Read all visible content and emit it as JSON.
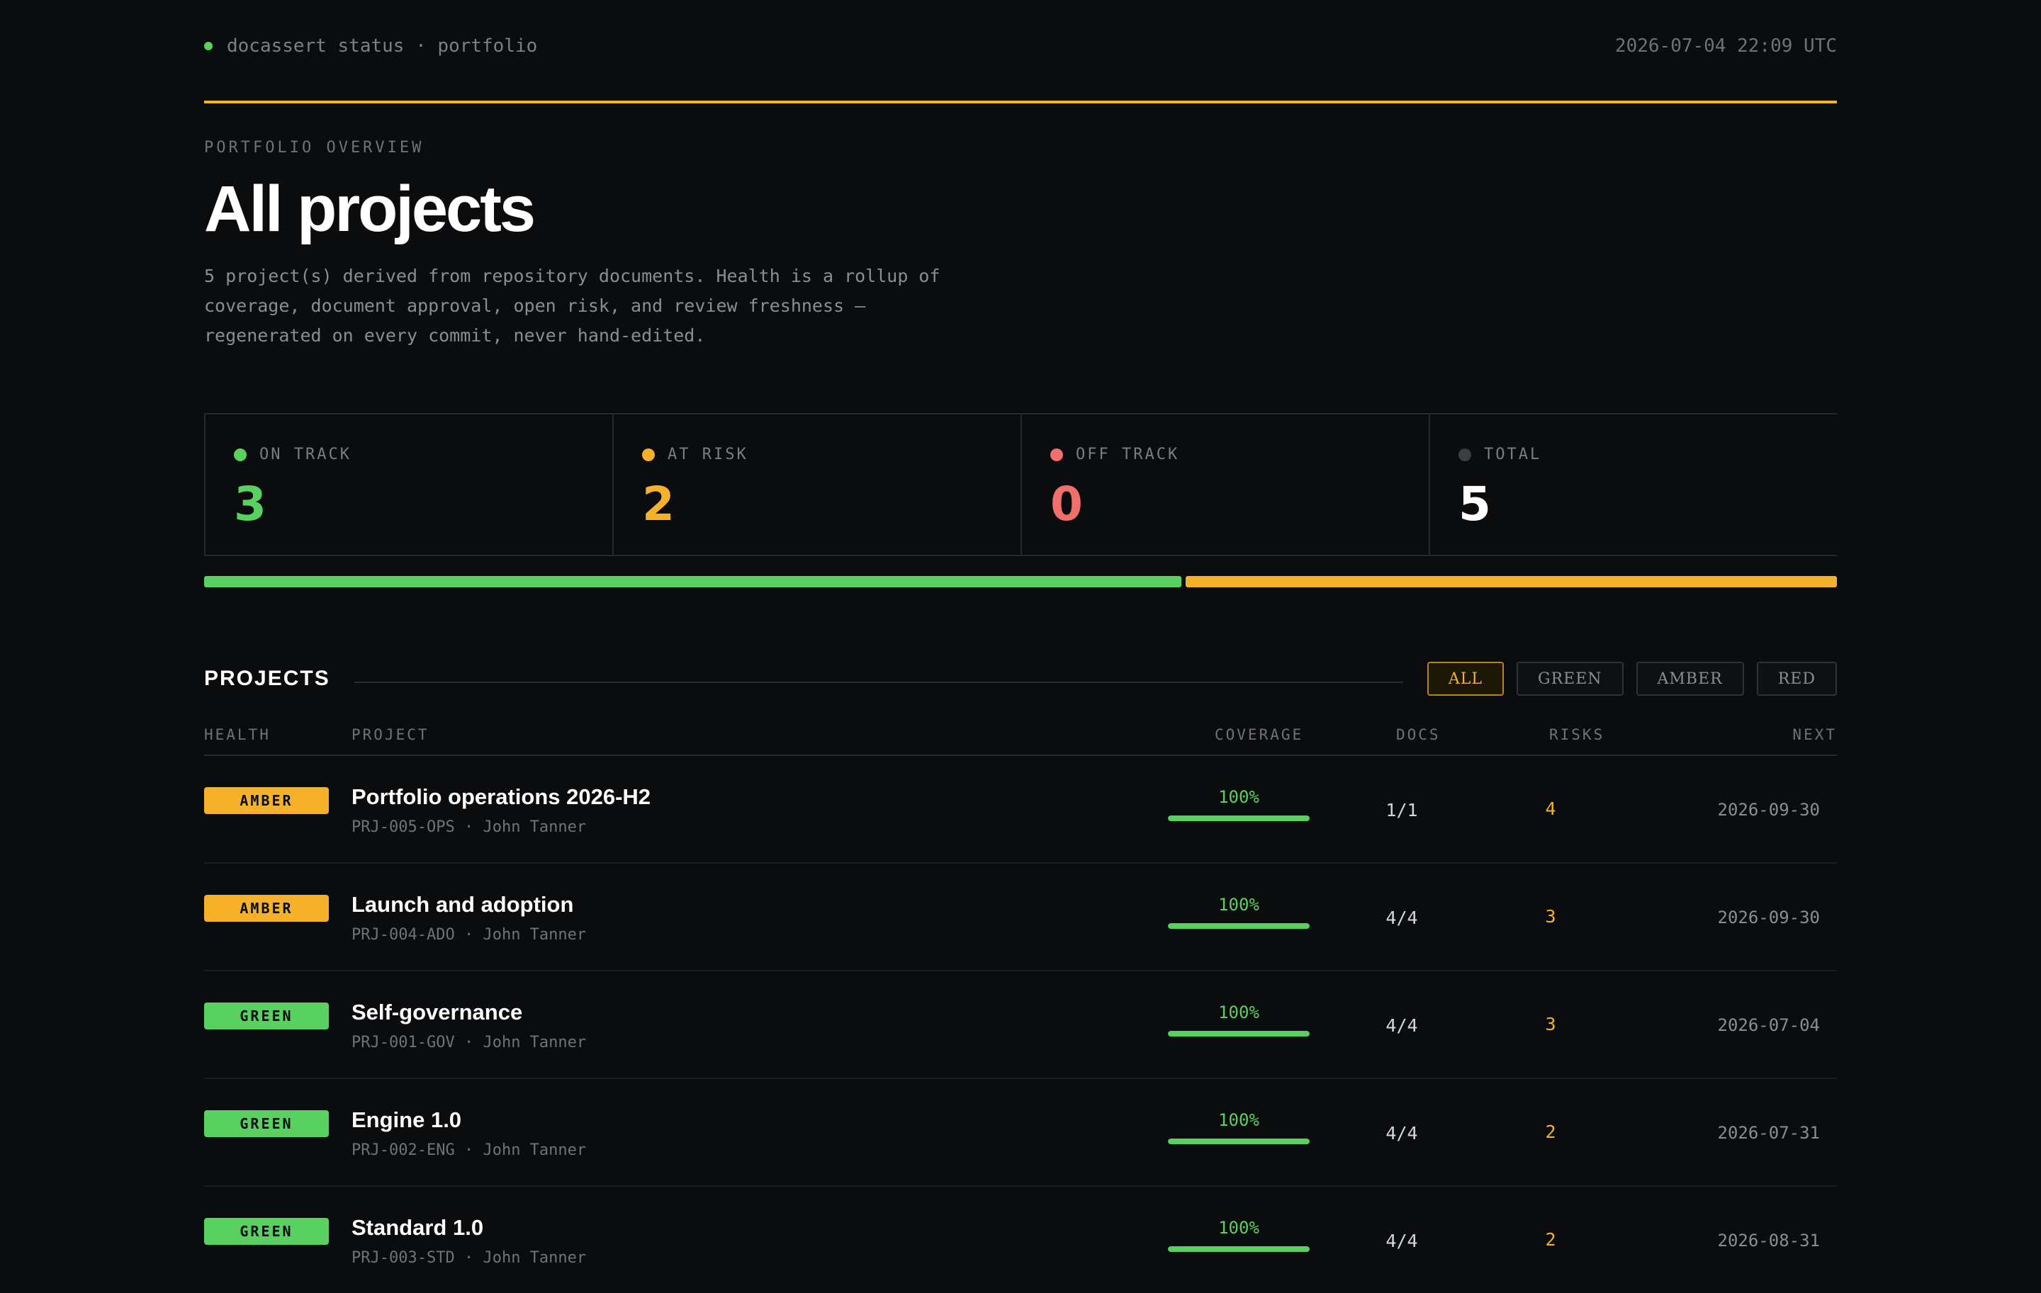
{
  "header": {
    "brand": "docassert status · portfolio",
    "timestamp": "2026-07-04 22:09 UTC"
  },
  "hero": {
    "eyebrow": "PORTFOLIO OVERVIEW",
    "title": "All projects",
    "description": "5 project(s) derived from repository documents. Health is a rollup of coverage, document approval, open risk, and review freshness — regenerated on every commit, never hand-edited."
  },
  "stats": [
    {
      "label": "ON TRACK",
      "value": "3",
      "color": "#59d160"
    },
    {
      "label": "AT RISK",
      "value": "2",
      "color": "#f5b12a"
    },
    {
      "label": "OFF TRACK",
      "value": "0",
      "color": "#ef6f6c"
    },
    {
      "label": "TOTAL",
      "value": "5",
      "color": "#ffffff",
      "dot_color": "#3b3e42"
    }
  ],
  "health_bar": [
    {
      "status": "green",
      "count": 3,
      "color": "#59d160"
    },
    {
      "status": "amber",
      "count": 2,
      "color": "#f5b12a"
    }
  ],
  "projects_section": {
    "title": "PROJECTS",
    "filters": [
      {
        "label": "ALL",
        "active": true
      },
      {
        "label": "GREEN",
        "active": false
      },
      {
        "label": "AMBER",
        "active": false
      },
      {
        "label": "RED",
        "active": false
      }
    ],
    "columns": {
      "health": "HEALTH",
      "project": "PROJECT",
      "coverage": "COVERAGE",
      "docs": "DOCS",
      "risks": "RISKS",
      "next": "NEXT"
    }
  },
  "projects": [
    {
      "health": "AMBER",
      "health_color": "#f5b12a",
      "name": "Portfolio operations 2026-H2",
      "id": "PRJ-005-OPS",
      "owner": "John Tanner",
      "coverage": "100%",
      "coverage_pct": 100,
      "docs": "1/1",
      "risks": "4",
      "next": "2026-09-30"
    },
    {
      "health": "AMBER",
      "health_color": "#f5b12a",
      "name": "Launch and adoption",
      "id": "PRJ-004-ADO",
      "owner": "John Tanner",
      "coverage": "100%",
      "coverage_pct": 100,
      "docs": "4/4",
      "risks": "3",
      "next": "2026-09-30"
    },
    {
      "health": "GREEN",
      "health_color": "#59d160",
      "name": "Self-governance",
      "id": "PRJ-001-GOV",
      "owner": "John Tanner",
      "coverage": "100%",
      "coverage_pct": 100,
      "docs": "4/4",
      "risks": "3",
      "next": "2026-07-04"
    },
    {
      "health": "GREEN",
      "health_color": "#59d160",
      "name": "Engine 1.0",
      "id": "PRJ-002-ENG",
      "owner": "John Tanner",
      "coverage": "100%",
      "coverage_pct": 100,
      "docs": "4/4",
      "risks": "2",
      "next": "2026-07-31"
    },
    {
      "health": "GREEN",
      "health_color": "#59d160",
      "name": "Standard 1.0",
      "id": "PRJ-003-STD",
      "owner": "John Tanner",
      "coverage": "100%",
      "coverage_pct": 100,
      "docs": "4/4",
      "risks": "2",
      "next": "2026-08-31"
    }
  ]
}
